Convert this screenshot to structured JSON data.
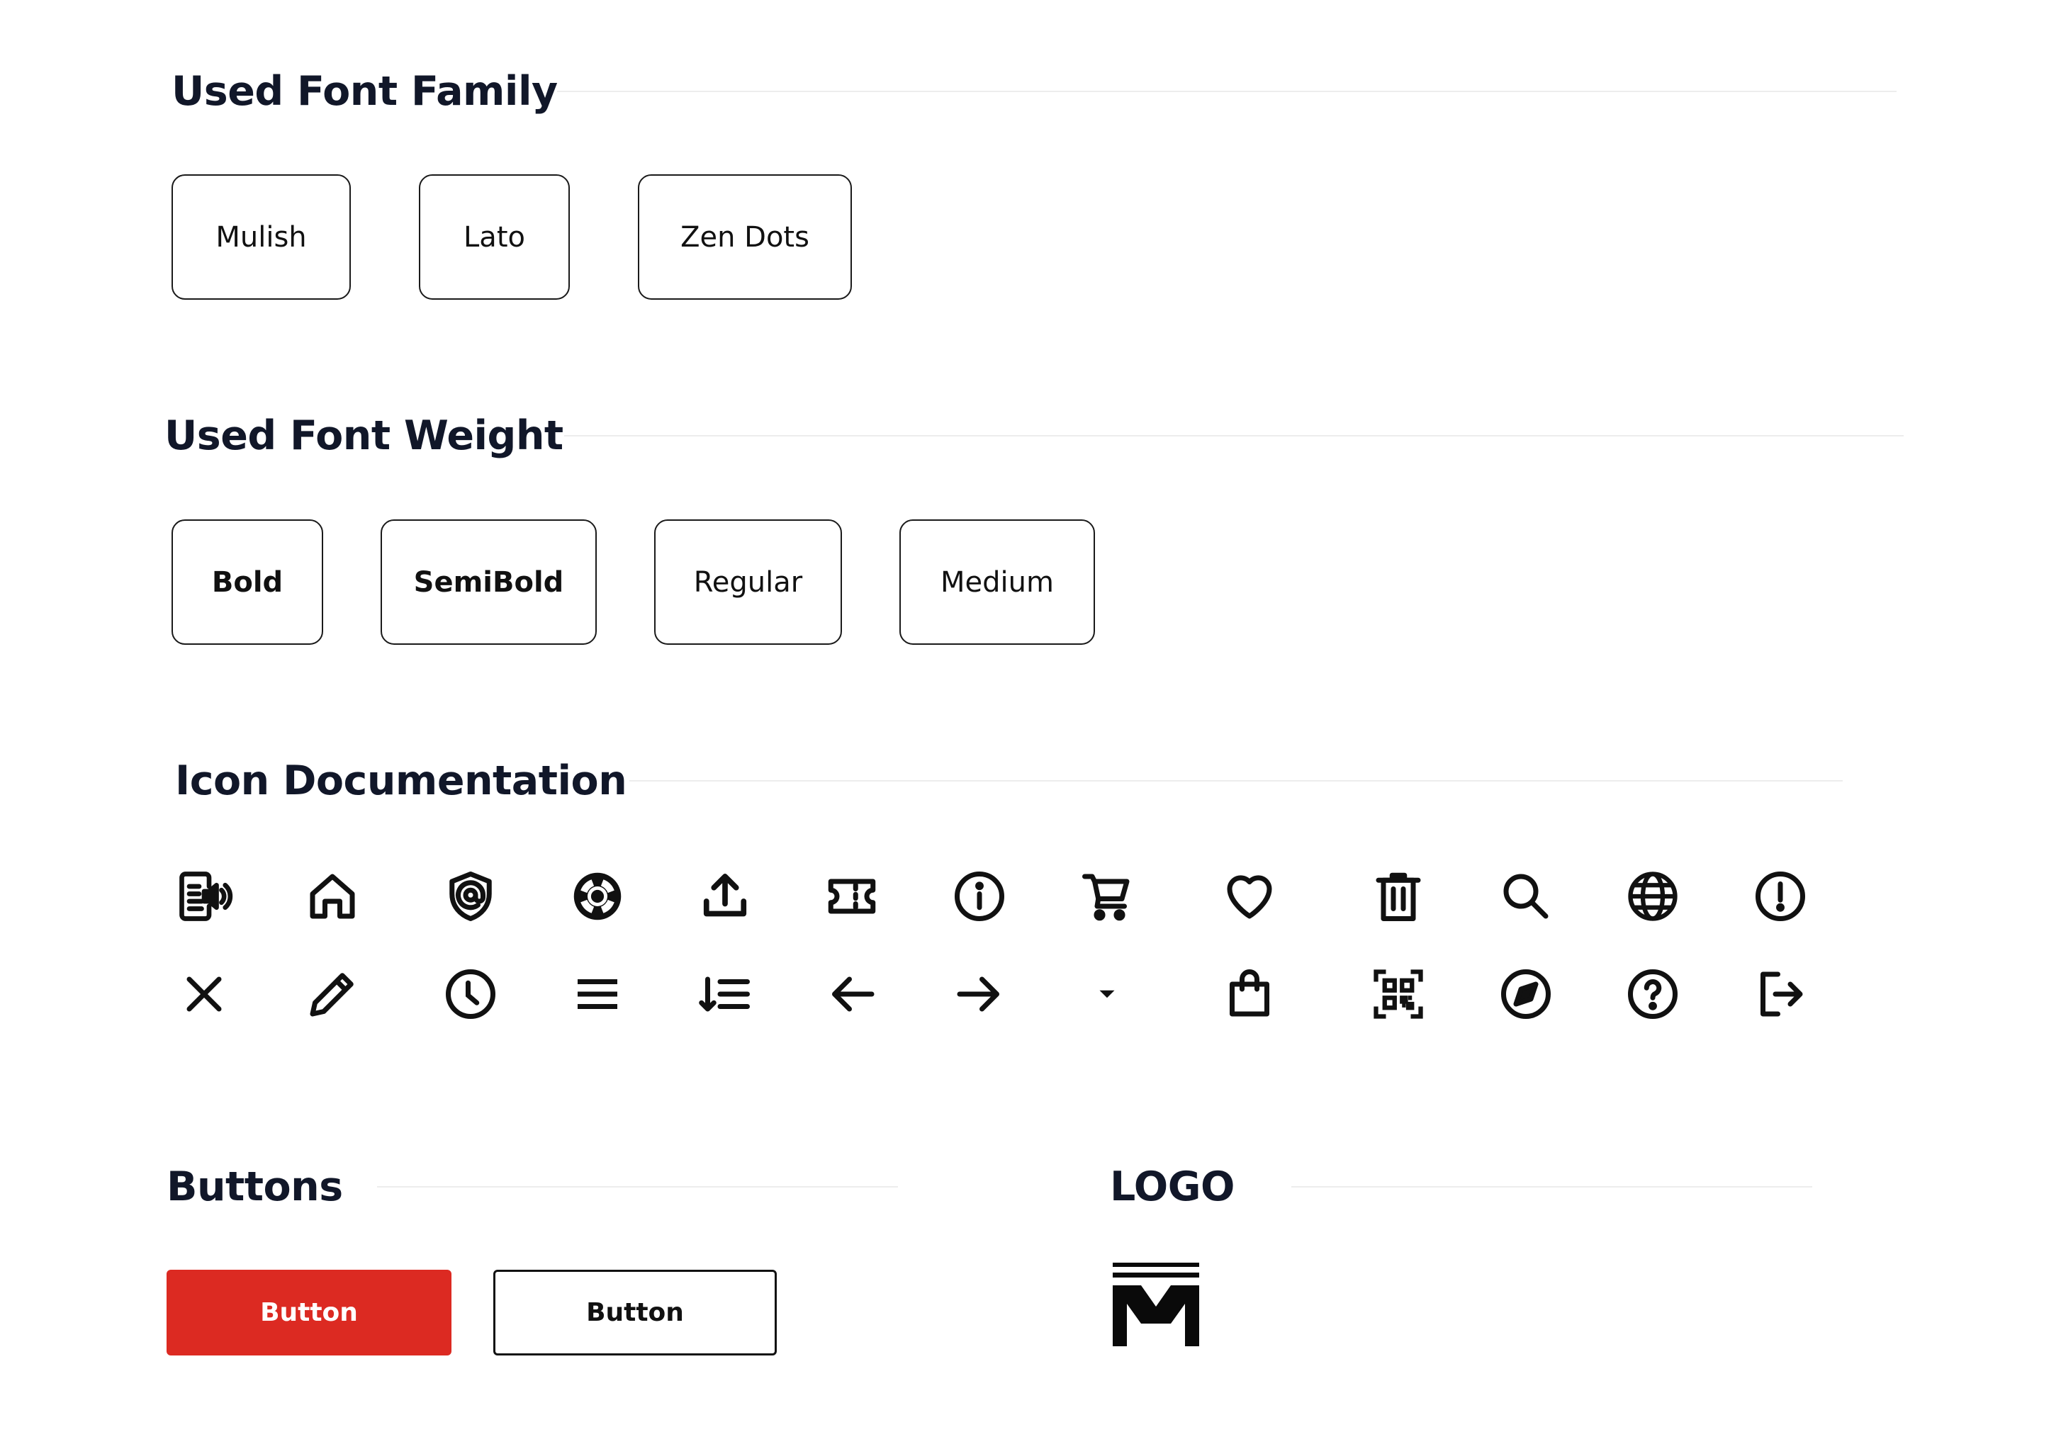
{
  "font_family": {
    "title": "Used Font Family",
    "items": [
      "Mulish",
      "Lato",
      "Zen Dots"
    ]
  },
  "font_weight": {
    "title": "Used Font Weight",
    "items": [
      "Bold",
      "SemiBold",
      "Regular",
      "Medium"
    ]
  },
  "icons": {
    "title": "Icon Documentation",
    "row1": [
      "news-speaker-icon",
      "home-icon",
      "shield-at-icon",
      "lifebuoy-icon",
      "upload-icon",
      "ticket-icon",
      "info-circle-icon",
      "cart-icon",
      "heart-icon",
      "trash-icon",
      "search-icon",
      "globe-icon",
      "alert-circle-icon"
    ],
    "row2": [
      "close-icon",
      "pencil-icon",
      "clock-icon",
      "menu-icon",
      "sort-list-icon",
      "arrow-left-icon",
      "arrow-right-icon",
      "caret-down-icon",
      "shopping-bag-icon",
      "qr-code-icon",
      "compass-icon",
      "help-circle-icon",
      "logout-icon"
    ]
  },
  "buttons": {
    "title": "Buttons",
    "primary_label": "Button",
    "secondary_label": "Button",
    "primary_color": "#dc2a22"
  },
  "logo": {
    "title": "LOGO",
    "icon": "m-logo-mark"
  }
}
